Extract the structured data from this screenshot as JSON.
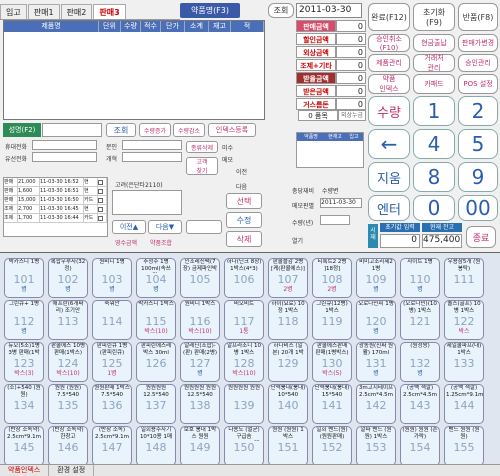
{
  "tabs": [
    {
      "label": "입고"
    },
    {
      "label": "판매1"
    },
    {
      "label": "판매2"
    },
    {
      "label": "판매3",
      "active": true
    }
  ],
  "drug_name_btn": "약품명(F3)",
  "lookup_btn": "조회",
  "date_value": "2011-03-30",
  "grid_columns": [
    "제품명",
    "단위",
    "수량",
    "적수",
    "단가",
    "소계",
    "재고",
    "적"
  ],
  "totals": [
    {
      "label": "판매금액",
      "value": "0",
      "style": "pink"
    },
    {
      "label": "할인금액",
      "value": "0",
      "style": ""
    },
    {
      "label": "외상금액",
      "value": "0",
      "style": ""
    },
    {
      "label": "조제+기타",
      "value": "0",
      "style": ""
    },
    {
      "label": "받을금액",
      "value": "0",
      "style": "dark"
    },
    {
      "label": "받은금액",
      "value": "0",
      "style": ""
    },
    {
      "label": "거스름돈",
      "value": "0",
      "style": ""
    }
  ],
  "item_count_label": "0 품목",
  "external_amount_label": "외상누금",
  "right_buttons": {
    "complete": "완료(F12)",
    "reset": "초기화\n(F9)",
    "return": "반품(F8)",
    "approval_cancel": "승인취소\n(F10)",
    "cash_out": "현금출납",
    "price_change": "판매가변경",
    "product_reg": "제품관리",
    "customer_mgmt": "거래처\n관리",
    "approval_mgmt": "승인관리",
    "drug_info": "약품\n인덱스",
    "card_pad": "카패드",
    "pos_settings": "POS 설정"
  },
  "keypad": {
    "qty_label": "수량",
    "erase_label": "지움",
    "enter_label": "엔터",
    "back_label": "←",
    "digits": [
      "1",
      "2",
      "3",
      "4",
      "5",
      "6",
      "7",
      "8",
      "9",
      "0",
      "00"
    ]
  },
  "city_label": "시재",
  "cash_start_label": "초기값 입력",
  "cash_current_label": "현재 잔고",
  "cash_start_value": "0",
  "cash_current_value": "475,400",
  "exit_btn": "종료",
  "member": {
    "label": "성명(F2)",
    "lookup": "조회",
    "qty_modify": "수량증가",
    "qty_decrease": "수량감소",
    "index_reg": "인덱스등록",
    "mobile_label": "휴대전화",
    "home_label": "유선전화",
    "memo1": "분인",
    "memo2": "개혁",
    "combo_label": "종류삭제",
    "note_label": "미수",
    "customer_search": "고객\n찾기",
    "memo_label": "메모",
    "prev_label": "이전",
    "next_label": "다음",
    "confirm_label": "고려(은단타2110)",
    "buy_label": "구매수",
    "payment_label": "선택",
    "modify_label": "수정",
    "delete_label": "삭제",
    "prev_btn": "이전▲",
    "next_btn": "다음▼",
    "receipt": "영수금액",
    "product_combo": "약품조합",
    "card_label": "출력"
  },
  "sale_rows": [
    {
      "type": "판매",
      "amount": "21,000",
      "time": "11-03-30 16:52",
      "method": "현"
    },
    {
      "type": "판매",
      "amount": "1,600",
      "time": "11-03-30 16:51",
      "method": "현"
    },
    {
      "type": "판매",
      "amount": "15,000",
      "time": "11-03-30 16:50",
      "method": "카드"
    },
    {
      "type": "조제",
      "amount": "2,700",
      "time": "11-03-30 16:45",
      "method": "현"
    },
    {
      "type": "조제",
      "amount": "1,700",
      "time": "11-03-30 16:44",
      "method": "카드"
    }
  ],
  "inv_columns": [
    "약품명",
    "현재고",
    "입고"
  ],
  "inv_labels": {
    "purchase_total": "충당재비",
    "stock_label": "수량변",
    "memo_date": "메모판별",
    "date": "2011-03-30",
    "qty_label": "수량(년)",
    "open_label": "열기"
  },
  "tiles": [
    {
      "name": "박카스디 1병",
      "num": "101",
      "badge": "병",
      "bcolor": "blue"
    },
    {
      "name": "복합우루사(32정)",
      "num": "102",
      "badge": "병",
      "bcolor": "blue"
    },
    {
      "name": "원비디 1병",
      "num": "103",
      "badge": "병",
      "bcolor": "blue"
    },
    {
      "name": "추정주 1병 100ml(속쓰림)",
      "num": "104",
      "badge": "병",
      "bcolor": "blue"
    },
    {
      "name": "인조레신팩(7장) 금제파인박스(3)",
      "num": "105",
      "badge": "",
      "bcolor": "blue"
    },
    {
      "name": "하나(딘크 8장) 1박스(4*3)",
      "num": "106",
      "badge": "",
      "bcolor": "blue"
    },
    {
      "name": "판콜플감 2병 [케(판콜에스)]",
      "num": "107",
      "badge": "2병",
      "bcolor": "pink"
    },
    {
      "name": "티록트2 2병 ]18정]",
      "num": "108",
      "badge": "2병",
      "bcolor": "pink"
    },
    {
      "name": "비미고조리제2 1병",
      "num": "109",
      "badge": "병",
      "bcolor": "blue"
    },
    {
      "name": "사이트 1병",
      "num": "110",
      "badge": "병",
      "bcolor": "blue"
    },
    {
      "name": "우용삼5개 (원봉탁)",
      "num": "111",
      "badge": "",
      "bcolor": "blue"
    },
    {
      "name": "그린큐+ 1병",
      "num": "112",
      "badge": "병",
      "bcolor": "blue"
    },
    {
      "name": "애프란(6개짜리) 조기안",
      "num": "113",
      "badge": "",
      "bcolor": "blue"
    },
    {
      "name": "숙워안",
      "num": "114",
      "badge": "",
      "bcolor": "blue"
    },
    {
      "name": "박카스디 1박스",
      "num": "115",
      "badge": "박스(10)",
      "bcolor": "pink"
    },
    {
      "name": "원비디 1박스",
      "num": "116",
      "badge": "박스(10)",
      "bcolor": "pink"
    },
    {
      "name": "비오비트",
      "num": "117",
      "badge": "1통",
      "bcolor": "pink"
    },
    {
      "name": "하이(요료) 10정 1박스",
      "num": "118",
      "badge": "",
      "bcolor": "blue"
    },
    {
      "name": "그린큐(12병) 1박스",
      "num": "119",
      "badge": "",
      "bcolor": "blue"
    },
    {
      "name": "오로나민씨 1병",
      "num": "120",
      "badge": "병",
      "bcolor": "blue"
    },
    {
      "name": "(오로나민)(10병) 1박스",
      "num": "121",
      "badge": "",
      "bcolor": "blue"
    },
    {
      "name": "솔스(골프) 10병 1박스",
      "num": "122",
      "badge": "박스",
      "bcolor": "pink"
    },
    {
      "name": "듀오(5조)1병 3병 판매(1박스)",
      "num": "123",
      "badge": "박스(3)",
      "bcolor": "pink"
    },
    {
      "name": "판콜에스 10병 판매(1박스)",
      "num": "124",
      "badge": "박스(10)",
      "bcolor": "pink"
    },
    {
      "name": "판피린큐 1병 (판피린큐)",
      "num": "125",
      "badge": "1병",
      "bcolor": "pink"
    },
    {
      "name": "판피린에스레 박스 30ml",
      "num": "126",
      "badge": "",
      "bcolor": "blue"
    },
    {
      "name": "알레닌(조합)-(판) 판매(2병)",
      "num": "127",
      "badge": "병",
      "bcolor": "blue"
    },
    {
      "name": "알프라조니 10병 1박스",
      "num": "128",
      "badge": "박스(10)",
      "bcolor": "pink"
    },
    {
      "name": "하나비스 (일본) 20개 1박스",
      "num": "129",
      "badge": "",
      "bcolor": "blue"
    },
    {
      "name": "판콜에스판매 판매(1병박스)",
      "num": "130",
      "badge": "박스(5)",
      "bcolor": "pink"
    },
    {
      "name": "광동원(진짜 원활) 170ml",
      "num": "131",
      "badge": "병",
      "bcolor": "blue"
    },
    {
      "name": "(원정쌍)",
      "num": "132",
      "badge": "병",
      "bcolor": "blue"
    },
    {
      "name": "제일쿨파프(대) 1박스 (10cm*15cm) (대형)",
      "num": "133",
      "badge": "",
      "bcolor": "blue"
    },
    {
      "name": "(소)+540 (원원)",
      "num": "134",
      "badge": "",
      "bcolor": "blue"
    },
    {
      "name": "원원 (원원) 7.5*540",
      "num": "135",
      "badge": "",
      "bcolor": "blue"
    },
    {
      "name": "원원판매 1박스 7.5*540",
      "num": "136",
      "badge": "",
      "bcolor": "blue"
    },
    {
      "name": "원원원원 12.5*540",
      "num": "137",
      "badge": "",
      "bcolor": "blue"
    },
    {
      "name": "원원원원 원원 12.5*540",
      "num": "138",
      "badge": "",
      "bcolor": "blue"
    },
    {
      "name": "원원원원 원원",
      "num": "139",
      "badge": "",
      "bcolor": "blue"
    },
    {
      "name": "단력붕대(붕대) 10*540",
      "num": "140",
      "badge": "",
      "bcolor": "blue"
    },
    {
      "name": "단력붕대(붕대) 15*540",
      "num": "141",
      "badge": "",
      "bcolor": "blue"
    },
    {
      "name": "3m고지테이프 2.5cm*4.5m",
      "num": "142",
      "badge": "",
      "bcolor": "blue"
    },
    {
      "name": "(공백 색깔) 2.5cm*4.5m",
      "num": "143",
      "badge": "",
      "bcolor": "blue"
    },
    {
      "name": "(공백 색깔) 1.25cm*9.1m",
      "num": "144",
      "badge": "",
      "bcolor": "blue"
    },
    {
      "name": "(반창 소독약) 2.5cm*9.1m",
      "num": "145",
      "badge": "",
      "bcolor": "blue"
    },
    {
      "name": "(반창 소독약) 한창고 1.25cm*9.1m",
      "num": "146",
      "badge": "",
      "bcolor": "blue"
    },
    {
      "name": "(반창 소독) 2.5cm*9.1m",
      "num": "147",
      "badge": "",
      "bcolor": "blue"
    },
    {
      "name": "일회용주사기 10*10용 1매",
      "num": "148",
      "badge": "",
      "bcolor": "blue"
    },
    {
      "name": "보호 붕대 1박스 원원",
      "num": "149",
      "badge": "",
      "bcolor": "blue"
    },
    {
      "name": "다용도 (멸균) 구급솜 7*4cm(10매)",
      "num": "150",
      "badge": "",
      "bcolor": "blue"
    },
    {
      "name": "원원 (원원) 1박스",
      "num": "151",
      "badge": "",
      "bcolor": "blue"
    },
    {
      "name": "일회 밴드(원) (원원판매)",
      "num": "152",
      "badge": "",
      "bcolor": "blue"
    },
    {
      "name": "알파 밴드 (원원) 1박스",
      "num": "153",
      "badge": "",
      "bcolor": "blue"
    },
    {
      "name": "(원원) 원원 (손가락)",
      "num": "154",
      "badge": "",
      "bcolor": "blue"
    },
    {
      "name": "밴드 원원 (원원)",
      "num": "155",
      "badge": "",
      "bcolor": "blue"
    }
  ],
  "status_bar": [
    "약품인덱스",
    "환경 설정"
  ]
}
